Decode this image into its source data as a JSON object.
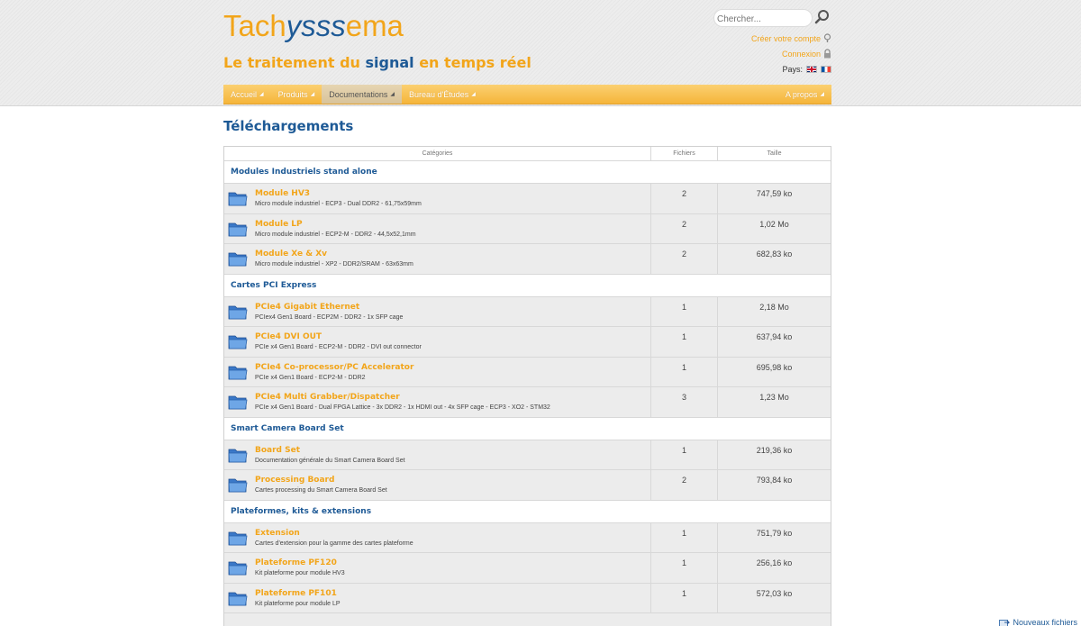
{
  "brand": {
    "logo_start": "Tach",
    "logo_mid": "ysss",
    "logo_end": "ema",
    "tagline_start": "Le traitement du ",
    "tagline_highlight": "signal",
    "tagline_end": " en temps réel",
    "primary_color": "#f2a51a",
    "secondary_color": "#1e5a96"
  },
  "search": {
    "placeholder": "Chercher...",
    "icon": "search-icon"
  },
  "account": {
    "create_label": "Créer votre compte",
    "login_label": "Connexion",
    "country_label": "Pays:"
  },
  "nav": {
    "items": [
      {
        "label": "Accueil"
      },
      {
        "label": "Produits"
      },
      {
        "label": "Documentations"
      },
      {
        "label": "Bureau d'Études"
      }
    ],
    "right_label": "A propos"
  },
  "page": {
    "title": "Téléchargements"
  },
  "table": {
    "headers": {
      "categories": "Catégories",
      "files": "Fichiers",
      "size": "Taille"
    },
    "sections": [
      {
        "name": "Modules Industriels stand alone",
        "items": [
          {
            "title": "Module HV3",
            "desc": "Micro module industriel - ECP3 - Dual DDR2 - 61,75x59mm",
            "files": "2",
            "size": "747,59 ko"
          },
          {
            "title": "Module LP",
            "desc": "Micro module industriel - ECP2-M - DDR2 - 44,5x52,1mm",
            "files": "2",
            "size": "1,02 Mo"
          },
          {
            "title": "Module Xe & Xv",
            "desc": "Micro module industriel - XP2 - DDR2/SRAM - 63x63mm",
            "files": "2",
            "size": "682,83 ko"
          }
        ]
      },
      {
        "name": "Cartes PCI Express",
        "items": [
          {
            "title": "PCIe4 Gigabit Ethernet",
            "desc": "PCIex4 Gen1 Board - ECP2M - DDR2 - 1x SFP cage",
            "files": "1",
            "size": "2,18 Mo"
          },
          {
            "title": "PCIe4 DVI OUT",
            "desc": "PCIe x4 Gen1 Board - ECP2-M - DDR2 - DVI out connector",
            "files": "1",
            "size": "637,94 ko"
          },
          {
            "title": "PCIe4 Co-processor/PC Accelerator",
            "desc": "PCIe x4 Gen1 Board - ECP2-M - DDR2",
            "files": "1",
            "size": "695,98 ko"
          },
          {
            "title": "PCIe4 Multi Grabber/Dispatcher",
            "desc": "PCIe x4 Gen1 Board - Dual FPGA Lattice - 3x DDR2 - 1x HDMI out - 4x SFP cage - ECP3 - XO2 - STM32",
            "files": "3",
            "size": "1,23 Mo"
          }
        ]
      },
      {
        "name": "Smart Camera Board Set",
        "items": [
          {
            "title": "Board Set",
            "desc": "Documentation générale du Smart Camera Board Set",
            "files": "1",
            "size": "219,36 ko"
          },
          {
            "title": "Processing Board",
            "desc": "Cartes processing du Smart Camera Board Set",
            "files": "2",
            "size": "793,84 ko"
          }
        ]
      },
      {
        "name": "Plateformes, kits & extensions",
        "items": [
          {
            "title": "Extension",
            "desc": "Cartes d'extension pour la gamme des cartes plateforme",
            "files": "1",
            "size": "751,79 ko"
          },
          {
            "title": "Plateforme PF120",
            "desc": "Kit plateforme pour module HV3",
            "files": "1",
            "size": "256,16 ko"
          },
          {
            "title": "Plateforme PF101",
            "desc": "Kit plateforme pour module LP",
            "files": "1",
            "size": "572,03 ko"
          }
        ]
      }
    ],
    "footer_link": "Nouveaux fichiers"
  }
}
